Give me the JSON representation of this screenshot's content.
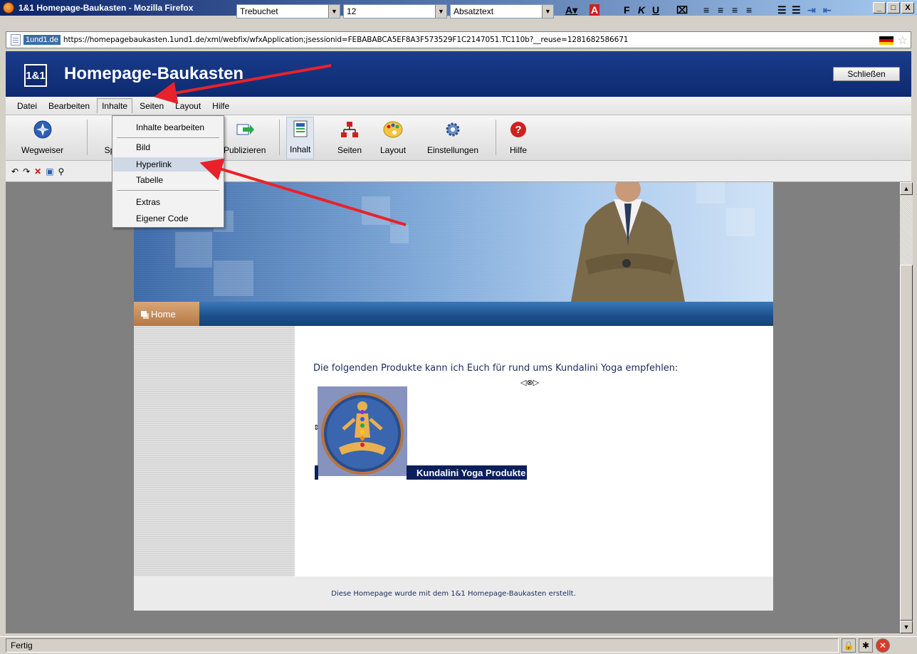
{
  "window": {
    "title": "1&1 Homepage-Baukasten - Mozilla Firefox",
    "buttons": [
      "_",
      "□",
      "X"
    ]
  },
  "urlbar": {
    "domain": "1und1.de",
    "url": "https://homepagebaukasten.1und1.de/xml/webfix/wfxApplication;jsessionid=FEBABABCA5EF8A3F573529F1C2147051.TC110b?__reuse=1281682586671"
  },
  "app": {
    "logo": "1&1",
    "title": "Homepage-Baukasten",
    "close_label": "Schließen"
  },
  "menu": {
    "items": [
      "Datei",
      "Bearbeiten",
      "Inhalte",
      "Seiten",
      "Layout",
      "Hilfe"
    ],
    "active": "Inhalte"
  },
  "dropdown": {
    "items": [
      "Inhalte bearbeiten",
      "Bild",
      "Hyperlink",
      "Tabelle",
      "Extras",
      "Eigener Code"
    ],
    "hovered": "Hyperlink"
  },
  "toolbar": {
    "wegweiser": "Wegweiser",
    "sp": "Sp",
    "publizieren": "Publizieren",
    "inhalt": "Inhalt",
    "seiten": "Seiten",
    "layout": "Layout",
    "einstellungen": "Einstellungen",
    "hilfe": "Hilfe"
  },
  "format": {
    "font": "Trebuchet",
    "size": "12",
    "style": "Absatztext"
  },
  "page": {
    "nav_home": "Home",
    "intro": "Die folgenden Produkte kann ich Euch für rund ums Kundalini Yoga empfehlen:",
    "product_label": "Kundalini Yoga Produkte",
    "footer": "Diese Homepage wurde mit dem 1&1 Homepage-Baukasten erstellt."
  },
  "status": {
    "text": "Fertig"
  },
  "colors": {
    "header": "#1a3c8c",
    "nav": "#1b4f8a",
    "home_tab": "#b47847",
    "annotation_arrow": "#e8222a"
  }
}
